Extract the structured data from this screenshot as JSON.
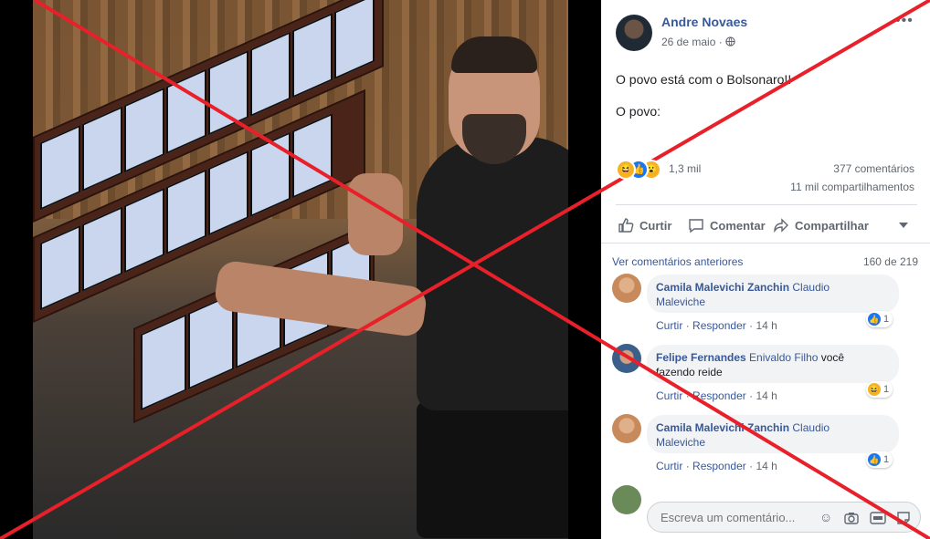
{
  "post": {
    "author": "Andre Novaes",
    "date": "26 de maio",
    "separator": "·",
    "privacy_icon": "globe-icon",
    "menu": "•••",
    "text_line1": "O povo está com o Bolsonaro!!",
    "text_line2": "O povo:"
  },
  "reactions": {
    "icons": [
      "haha-icon",
      "like-icon",
      "wow-icon"
    ],
    "count": "1,3 mil",
    "comments": "377 comentários",
    "shares": "11 mil compartilhamentos"
  },
  "actions": {
    "like": "Curtir",
    "comment": "Comentar",
    "share": "Compartilhar"
  },
  "comments_section": {
    "view_previous": "Ver comentários anteriores",
    "pagination": "160 de 219",
    "items": [
      {
        "name": "Camila Malevichi Zanchin",
        "tag_line1": "Claudio",
        "tag_line2": "Maleviche",
        "like": "Curtir",
        "reply": "Responder",
        "time": "14 h",
        "reaction_icon": "like-icon",
        "reaction_count": "1"
      },
      {
        "name": "Felipe Fernandes",
        "tag_line1": "Enivaldo Filho",
        "text_line1": " você",
        "text_line2": "fazendo reide",
        "like": "Curtir",
        "reply": "Responder",
        "time": "14 h",
        "reaction_icon": "haha-icon",
        "reaction_count": "1"
      },
      {
        "name": "Camila Malevichi Zanchin",
        "tag_line1": "Claudio",
        "tag_line2": "Maleviche",
        "like": "Curtir",
        "reply": "Responder",
        "time": "14 h",
        "reaction_icon": "like-icon",
        "reaction_count": "1"
      }
    ],
    "dot": "·"
  },
  "composer": {
    "placeholder": "Escreva um comentário...",
    "icons": [
      "emoji-icon",
      "camera-icon",
      "gif-icon",
      "sticker-icon"
    ]
  },
  "colors": {
    "link": "#385898",
    "cross": "#e8202a",
    "like_blue": "#1877f2",
    "haha_yellow": "#f7b125"
  }
}
